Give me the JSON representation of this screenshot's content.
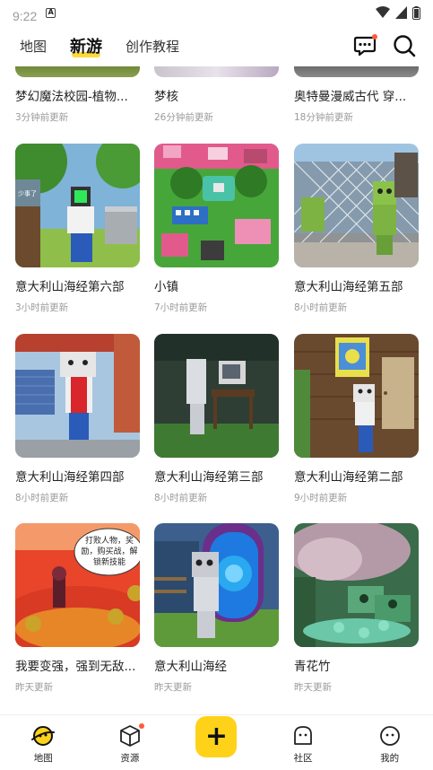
{
  "status_bar": {
    "time": "9:22"
  },
  "top_nav": {
    "tabs": [
      {
        "label": "地图",
        "active": false
      },
      {
        "label": "新游",
        "active": true
      },
      {
        "label": "创作教程",
        "active": false
      }
    ],
    "message_icon": "chat-bubble-icon",
    "search_icon": "search-icon"
  },
  "cards": [
    {
      "title": "梦幻魔法校园-植物...",
      "time": "3分钟前更新"
    },
    {
      "title": "梦核",
      "time": "26分钟前更新"
    },
    {
      "title": "奥特曼漫威古代  穿...",
      "time": "18分钟前更新"
    },
    {
      "title": "意大利山海经第六部",
      "time": "3小时前更新"
    },
    {
      "title": "小镇",
      "time": "7小时前更新"
    },
    {
      "title": "意大利山海经第五部",
      "time": "8小时前更新"
    },
    {
      "title": "意大利山海经第四部",
      "time": "8小时前更新"
    },
    {
      "title": "意大利山海经第三部",
      "time": "8小时前更新"
    },
    {
      "title": "意大利山海经第二部",
      "time": "9小时前更新"
    },
    {
      "title": "我要变强，强到无敌...",
      "time": "昨天更新"
    },
    {
      "title": "意大利山海经",
      "time": "昨天更新"
    },
    {
      "title": "青花竹",
      "time": "昨天更新"
    }
  ],
  "thumb_texts": {
    "sign": "少事了",
    "speech": "打败人物，奖励，购买战，解锁新技能"
  },
  "bottom_nav": {
    "map": "地图",
    "resources": "资源",
    "create": "+",
    "community": "社区",
    "mine": "我的"
  },
  "colors": {
    "accent": "#ffd21a",
    "badge": "#ff5a3c"
  }
}
